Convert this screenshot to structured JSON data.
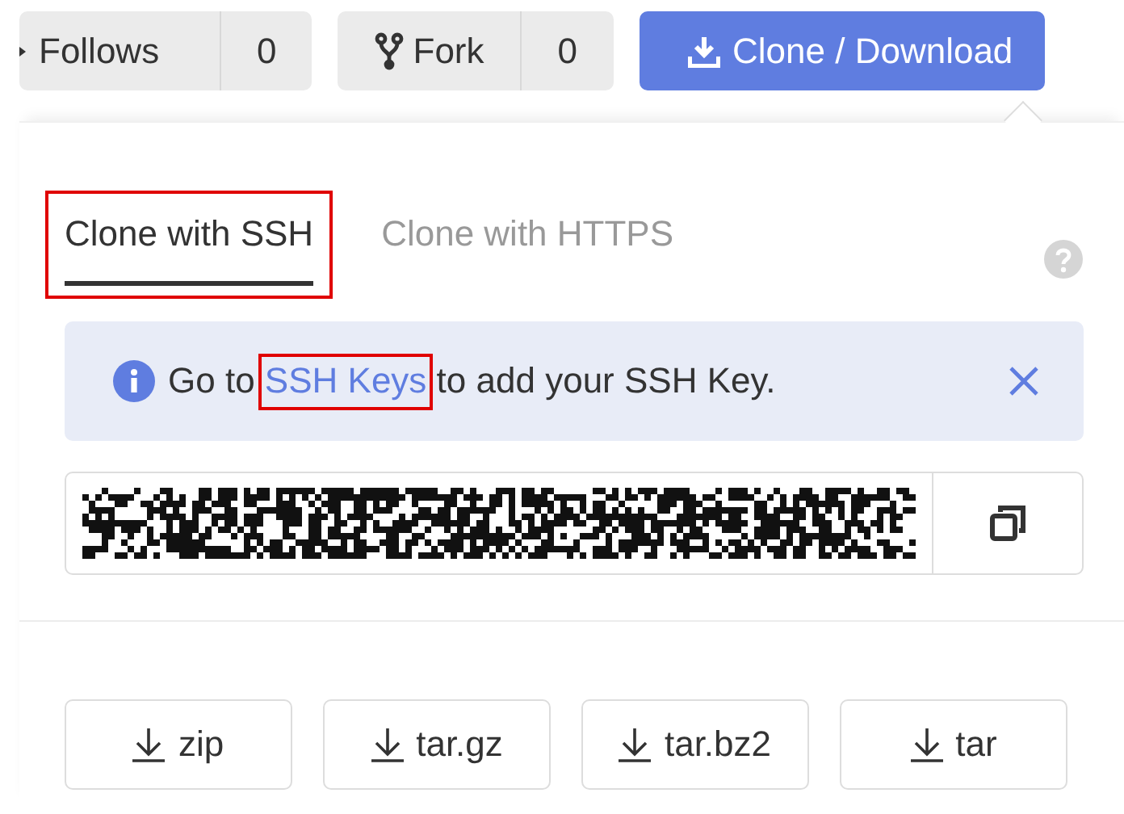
{
  "toolbar": {
    "buttons": [
      {
        "kind": "follow",
        "label": "Follows",
        "count": "0"
      },
      {
        "kind": "fork",
        "label": "Fork",
        "count": "0"
      }
    ],
    "clone_button": {
      "label": "Clone / Download"
    }
  },
  "panel": {
    "tabs": [
      {
        "label": "Clone with SSH",
        "selected": true,
        "highlighted": true
      },
      {
        "label": "Clone with HTTPS",
        "selected": false,
        "highlighted": false
      }
    ],
    "notice": {
      "before": "Go to",
      "link": "SSH Keys",
      "link_highlighted": true,
      "after": "to add your SSH Key."
    },
    "downloads": [
      {
        "label": "zip"
      },
      {
        "label": "tar.gz"
      },
      {
        "label": "tar.bz2"
      },
      {
        "label": "tar"
      }
    ]
  }
}
